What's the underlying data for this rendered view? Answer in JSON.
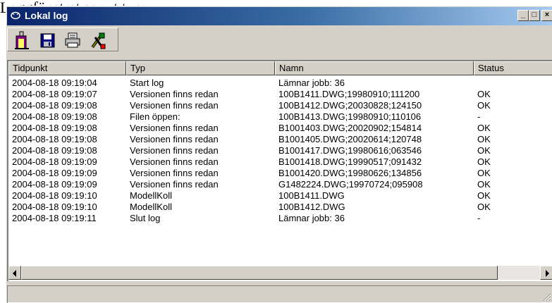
{
  "document_caption": "Loggfönstret ser ut typ:",
  "window": {
    "title": "Lokal log",
    "controls": {
      "minimize": "_",
      "maximize": "□",
      "close": "×"
    }
  },
  "toolbar": {
    "buttons": [
      {
        "name": "exit-icon",
        "color": "#800080"
      },
      {
        "name": "save-icon",
        "color": "#000080"
      },
      {
        "name": "print-icon",
        "color": "#000000"
      },
      {
        "name": "settings-tools-icon",
        "color": "#808000"
      }
    ]
  },
  "table": {
    "columns": [
      "Tidpunkt",
      "Typ",
      "Namn",
      "Status"
    ],
    "rows": [
      [
        "2004-08-18 09:19:04",
        "Start log",
        "Lämnar jobb: 36",
        ""
      ],
      [
        "2004-08-18 09:19:07",
        "Versionen finns redan",
        "100B1411.DWG;19980910;111200",
        "OK"
      ],
      [
        "2004-08-18 09:19:08",
        "Versionen finns redan",
        "100B1412.DWG;20030828;124150",
        "OK"
      ],
      [
        "2004-08-18 09:19:08",
        "Filen öppen:",
        "100B1413.DWG;19980910;110106",
        "-"
      ],
      [
        "2004-08-18 09:19:08",
        "Versionen finns redan",
        "B1001403.DWG;20020902;154814",
        "OK"
      ],
      [
        "2004-08-18 09:19:08",
        "Versionen finns redan",
        "B1001405.DWG;20020614;120748",
        "OK"
      ],
      [
        "2004-08-18 09:19:08",
        "Versionen finns redan",
        "B1001417.DWG;19980616;063546",
        "OK"
      ],
      [
        "2004-08-18 09:19:09",
        "Versionen finns redan",
        "B1001418.DWG;19990517;091432",
        "OK"
      ],
      [
        "2004-08-18 09:19:09",
        "Versionen finns redan",
        "B1001420.DWG;19980626;134856",
        "OK"
      ],
      [
        "2004-08-18 09:19:09",
        "Versionen finns redan",
        "G1482224.DWG;19970724;095908",
        "OK"
      ],
      [
        "2004-08-18 09:19:10",
        "ModellKoll",
        "100B1411.DWG",
        "OK"
      ],
      [
        "2004-08-18 09:19:10",
        "ModellKoll",
        "100B1412.DWG",
        "OK"
      ],
      [
        "2004-08-18 09:19:11",
        "Slut log",
        "Lämnar jobb: 36",
        "-"
      ]
    ]
  },
  "colors": {
    "titlebar_start": "#0a246a",
    "titlebar_end": "#a6caf0",
    "face": "#d4d0c8"
  }
}
